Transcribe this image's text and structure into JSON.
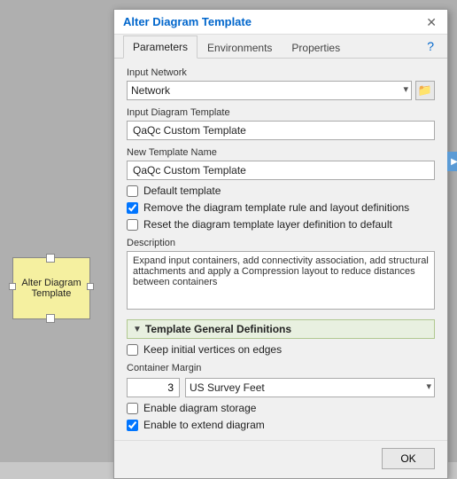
{
  "dialog": {
    "title": "Alter Diagram Template",
    "close_label": "✕",
    "help_icon": "?",
    "tabs": [
      {
        "label": "Parameters",
        "active": true
      },
      {
        "label": "Environments",
        "active": false
      },
      {
        "label": "Properties",
        "active": false
      }
    ],
    "fields": {
      "input_network_label": "Input Network",
      "input_network_value": "Network",
      "input_diagram_template_label": "Input Diagram Template",
      "input_diagram_template_value": "QaQc Custom Template",
      "new_template_name_label": "New Template Name",
      "new_template_name_value": "QaQc Custom Template",
      "default_template_label": "Default template",
      "default_template_checked": false,
      "remove_rules_label": "Remove the diagram template rule and layout definitions",
      "remove_rules_checked": true,
      "reset_layer_label": "Reset the diagram template layer definition to default",
      "reset_layer_checked": false,
      "description_label": "Description",
      "description_value": "Expand input containers, add connectivity association, add structural attachments and apply a Compression layout to reduce distances between containers"
    },
    "section": {
      "label": "Template General Definitions",
      "keep_initial_label": "Keep initial vertices on edges",
      "keep_initial_checked": false,
      "container_margin_label": "Container Margin",
      "container_margin_value": "3",
      "units_value": "US Survey Feet",
      "enable_storage_label": "Enable diagram storage",
      "enable_storage_checked": false,
      "enable_extend_label": "Enable to extend diagram",
      "enable_extend_checked": true
    },
    "footer": {
      "ok_label": "OK"
    }
  },
  "diagram_node": {
    "label": "Alter Diagram\nTemplate"
  }
}
